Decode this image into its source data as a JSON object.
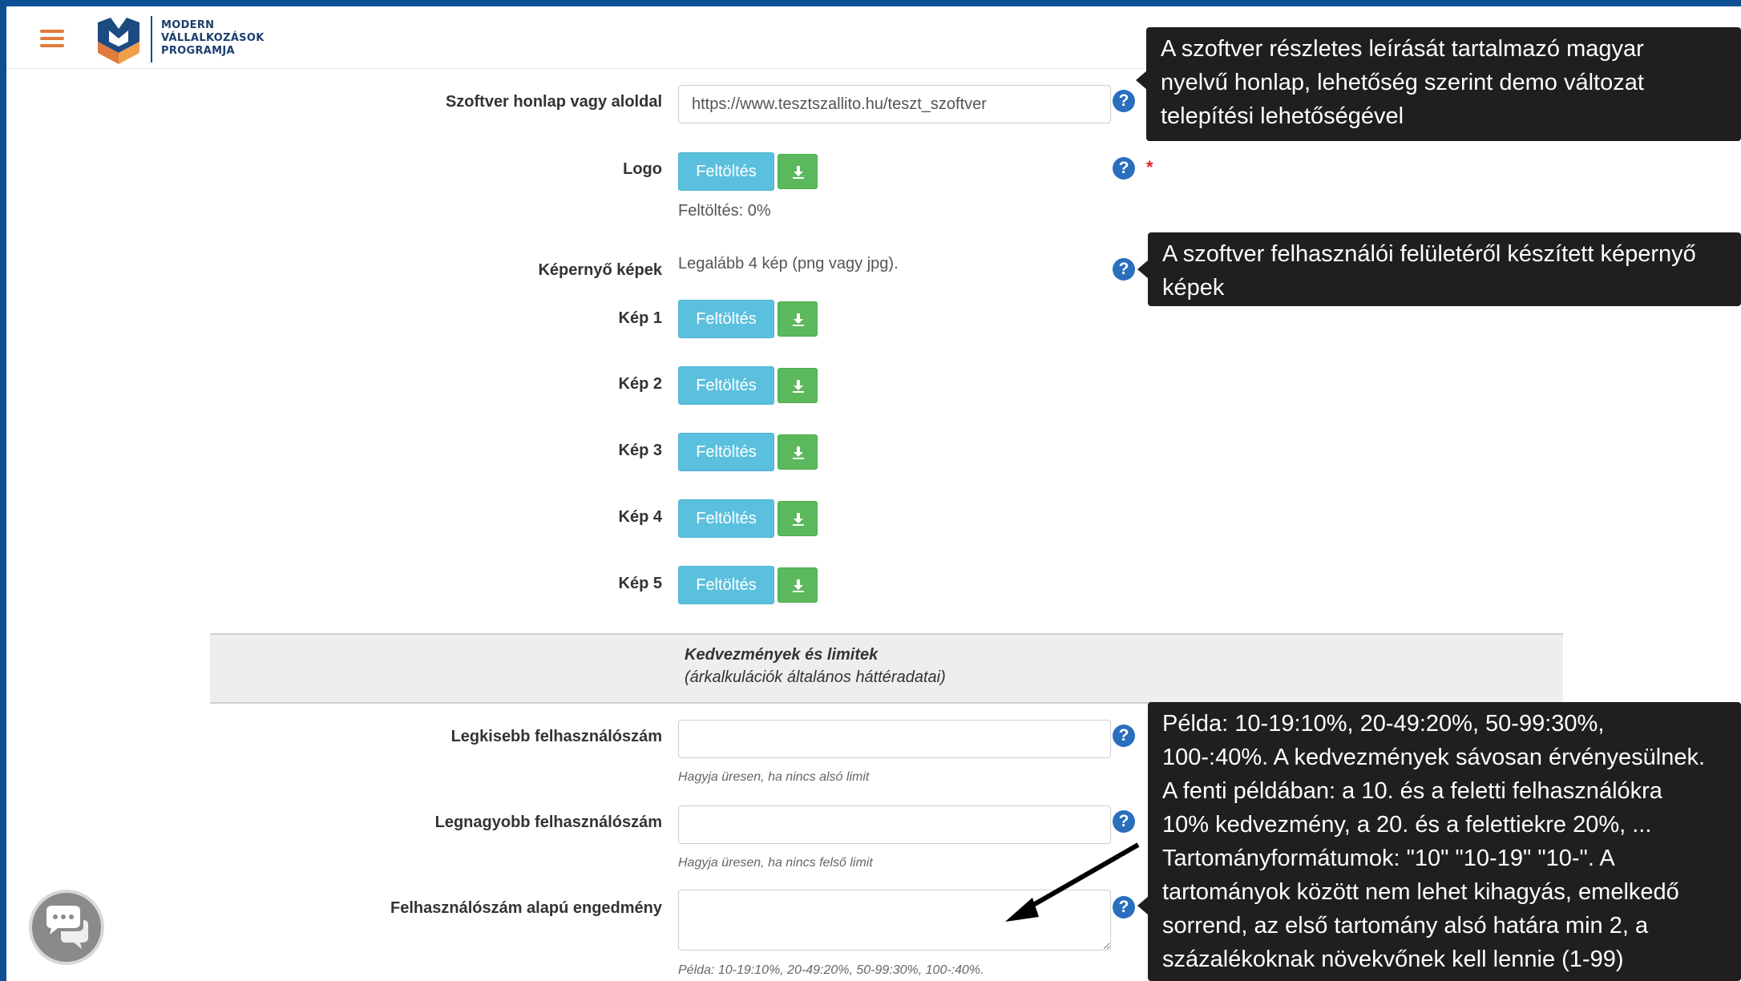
{
  "header": {
    "logo_line1": "MODERN",
    "logo_line2": "VÁLLALKOZÁSOK",
    "logo_line3": "PROGRAMJA",
    "menu_icon": "hamburger-icon",
    "logo_icon": "mvp-logo-icon"
  },
  "fields": {
    "homepage": {
      "label": "Szoftver honlap vagy aloldal",
      "value": "https://www.tesztszallito.hu/teszt_szoftver"
    },
    "logo": {
      "label": "Logo",
      "upload_label": "Feltöltés",
      "progress_text": "Feltöltés: 0%",
      "required_mark": "*"
    },
    "screenshots": {
      "label": "Képernyő képek",
      "note": "Legalább 4 kép (png vagy jpg).",
      "items": [
        {
          "label": "Kép 1",
          "upload_label": "Feltöltés"
        },
        {
          "label": "Kép 2",
          "upload_label": "Feltöltés"
        },
        {
          "label": "Kép 3",
          "upload_label": "Feltöltés"
        },
        {
          "label": "Kép 4",
          "upload_label": "Feltöltés"
        },
        {
          "label": "Kép 5",
          "upload_label": "Feltöltés"
        }
      ]
    },
    "min_users": {
      "label": "Legkisebb felhasználószám",
      "value": "",
      "hint": "Hagyja üresen, ha nincs alsó limit"
    },
    "max_users": {
      "label": "Legnagyobb felhasználószám",
      "value": "",
      "hint": "Hagyja üresen, ha nincs felső limit"
    },
    "user_discount": {
      "label": "Felhasználószám alapú engedmény",
      "value": "",
      "hint": "Példa: 10-19:10%, 20-49:20%, 50-99:30%, 100-:40%."
    }
  },
  "section": {
    "title": "Kedvezmények és limitek",
    "subtitle": "(árkalkulációk általános háttéradatai)"
  },
  "help_glyph": "?",
  "tooltips": {
    "homepage": [
      "A szoftver részletes leírását tartalmazó magyar",
      "nyelvű honlap, lehetőség szerint demo változat",
      "telepítési lehetőségével"
    ],
    "screenshots": [
      "A szoftver felhasználói felületéről készített képernyő",
      "képek"
    ],
    "discount": [
      "Példa: 10-19:10%, 20-49:20%, 50-99:30%,",
      "100-:40%. A kedvezmények sávosan érvényesülnek.",
      "A fenti példában: a 10. és a feletti felhasználókra",
      "10% kedvezmény, a 20. és a felettiekre 20%, ...",
      "Tartományformátumok: \"10\" \"10-19\" \"10-\". A",
      "tartományok között nem lehet kihagyás, emelkedő",
      "sorrend, az első tartomány alsó határa min 2, a",
      "százalékoknak növekvőnek kell lennie (1-99)"
    ]
  },
  "colors": {
    "frame": "#0d4f93",
    "accent_orange": "#e07b3c",
    "upload_button": "#5bc0de",
    "download_button": "#5cb85c",
    "help_icon": "#2a6fbd",
    "tooltip_bg": "#1f1f1f",
    "required": "#d9262c"
  }
}
